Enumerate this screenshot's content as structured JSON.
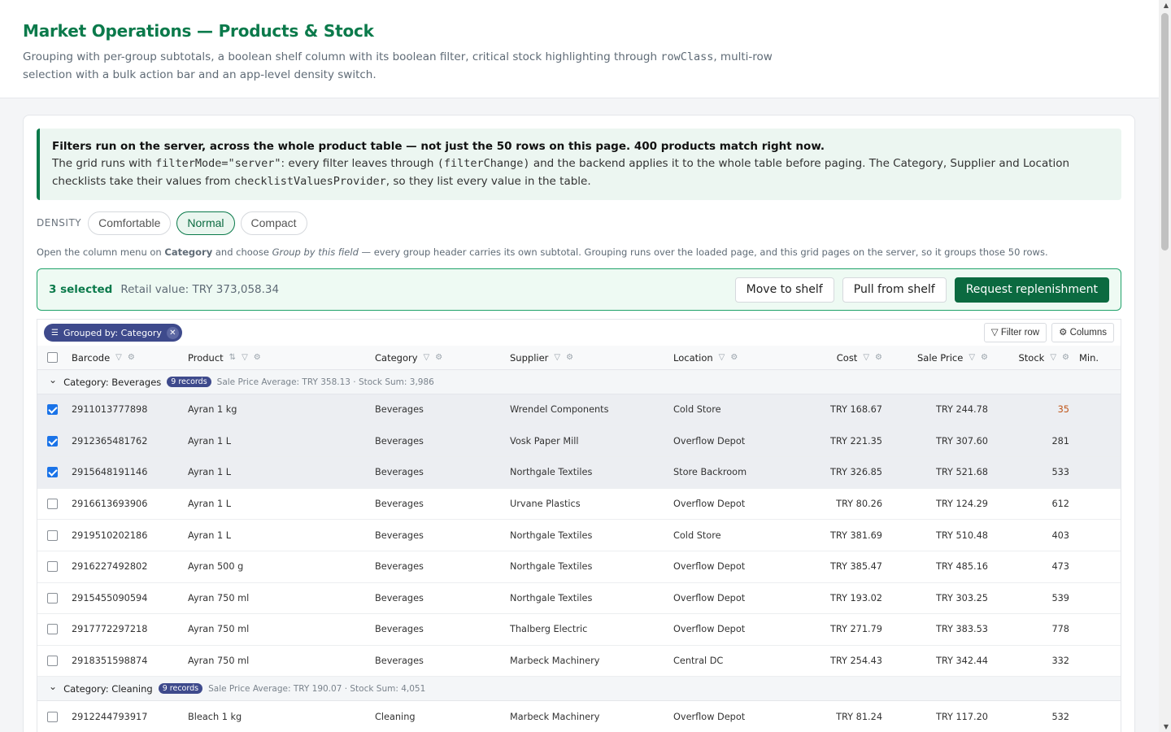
{
  "header": {
    "title": "Market Operations — Products & Stock",
    "subtitle_1": "Grouping with per-group subtotals, a boolean shelf column with its boolean filter, critical stock highlighting through ",
    "subtitle_code": "rowClass",
    "subtitle_2": ", multi-row selection with a bulk action bar and an app-level density switch."
  },
  "banner": {
    "strong": "Filters run on the server, across the whole product table — not just the 50 rows on this page. 400 products match right now.",
    "t1": "The grid runs with ",
    "c1": "filterMode=\"server\"",
    "t2": ": every filter leaves through ",
    "c2": "(filterChange)",
    "t3": " and the backend applies it to the whole table before paging. The Category, Supplier and Location checklists take their values from ",
    "c3": "checklistValuesProvider",
    "t4": ", so they list every value in the table."
  },
  "density": {
    "label": "DENSITY",
    "options": [
      "Comfortable",
      "Normal",
      "Compact"
    ],
    "selected": "Normal"
  },
  "hint": {
    "t1": "Open the column menu on ",
    "b1": "Category",
    "t2": " and choose ",
    "i1": "Group by this field",
    "t3": " — every group header carries its own subtotal. Grouping runs over the loaded page, and this grid pages on the server, so it groups those 50 rows."
  },
  "bulk": {
    "count": "3 selected",
    "value": "Retail value: TRY 373,058.34",
    "actions": [
      "Move to shelf",
      "Pull from shelf",
      "Request replenishment"
    ]
  },
  "toolbar": {
    "chip": "Grouped by: Category",
    "filter_row": "Filter row",
    "columns": "Columns"
  },
  "columns": [
    "Barcode",
    "Product",
    "Category",
    "Supplier",
    "Location",
    "Cost",
    "Sale Price",
    "Stock",
    "Min."
  ],
  "groups": [
    {
      "title": "Category: Beverages",
      "badge": "9 records",
      "summary": "Sale Price Average: TRY 358.13 · Stock Sum: 3,986",
      "rows": [
        {
          "selected": true,
          "critical": true,
          "barcode": "2911013777898",
          "product": "Ayran 1 kg",
          "category": "Beverages",
          "supplier": "Wrendel Components",
          "location": "Cold Store",
          "cost": "TRY 168.67",
          "price": "TRY 244.78",
          "stock": "35"
        },
        {
          "selected": true,
          "critical": false,
          "barcode": "2912365481762",
          "product": "Ayran 1 L",
          "category": "Beverages",
          "supplier": "Vosk Paper Mill",
          "location": "Overflow Depot",
          "cost": "TRY 221.35",
          "price": "TRY 307.60",
          "stock": "281"
        },
        {
          "selected": true,
          "critical": false,
          "barcode": "2915648191146",
          "product": "Ayran 1 L",
          "category": "Beverages",
          "supplier": "Northgale Textiles",
          "location": "Store Backroom",
          "cost": "TRY 326.85",
          "price": "TRY 521.68",
          "stock": "533"
        },
        {
          "selected": false,
          "critical": false,
          "barcode": "2916613693906",
          "product": "Ayran 1 L",
          "category": "Beverages",
          "supplier": "Urvane Plastics",
          "location": "Overflow Depot",
          "cost": "TRY 80.26",
          "price": "TRY 124.29",
          "stock": "612"
        },
        {
          "selected": false,
          "critical": false,
          "barcode": "2919510202186",
          "product": "Ayran 1 L",
          "category": "Beverages",
          "supplier": "Northgale Textiles",
          "location": "Cold Store",
          "cost": "TRY 381.69",
          "price": "TRY 510.48",
          "stock": "403"
        },
        {
          "selected": false,
          "critical": false,
          "barcode": "2916227492802",
          "product": "Ayran 500 g",
          "category": "Beverages",
          "supplier": "Northgale Textiles",
          "location": "Overflow Depot",
          "cost": "TRY 385.47",
          "price": "TRY 485.16",
          "stock": "473"
        },
        {
          "selected": false,
          "critical": false,
          "barcode": "2915455090594",
          "product": "Ayran 750 ml",
          "category": "Beverages",
          "supplier": "Northgale Textiles",
          "location": "Overflow Depot",
          "cost": "TRY 193.02",
          "price": "TRY 303.25",
          "stock": "539"
        },
        {
          "selected": false,
          "critical": false,
          "barcode": "2917772297218",
          "product": "Ayran 750 ml",
          "category": "Beverages",
          "supplier": "Thalberg Electric",
          "location": "Overflow Depot",
          "cost": "TRY 271.79",
          "price": "TRY 383.53",
          "stock": "778"
        },
        {
          "selected": false,
          "critical": false,
          "barcode": "2918351598874",
          "product": "Ayran 750 ml",
          "category": "Beverages",
          "supplier": "Marbeck Machinery",
          "location": "Central DC",
          "cost": "TRY 254.43",
          "price": "TRY 342.44",
          "stock": "332"
        }
      ]
    },
    {
      "title": "Category: Cleaning",
      "badge": "9 records",
      "summary": "Sale Price Average: TRY 190.07 · Stock Sum: 4,051",
      "rows": [
        {
          "selected": false,
          "critical": false,
          "barcode": "2912244793917",
          "product": "Bleach 1 kg",
          "category": "Cleaning",
          "supplier": "Marbeck Machinery",
          "location": "Overflow Depot",
          "cost": "TRY 81.24",
          "price": "TRY 117.20",
          "stock": "532"
        }
      ]
    }
  ]
}
